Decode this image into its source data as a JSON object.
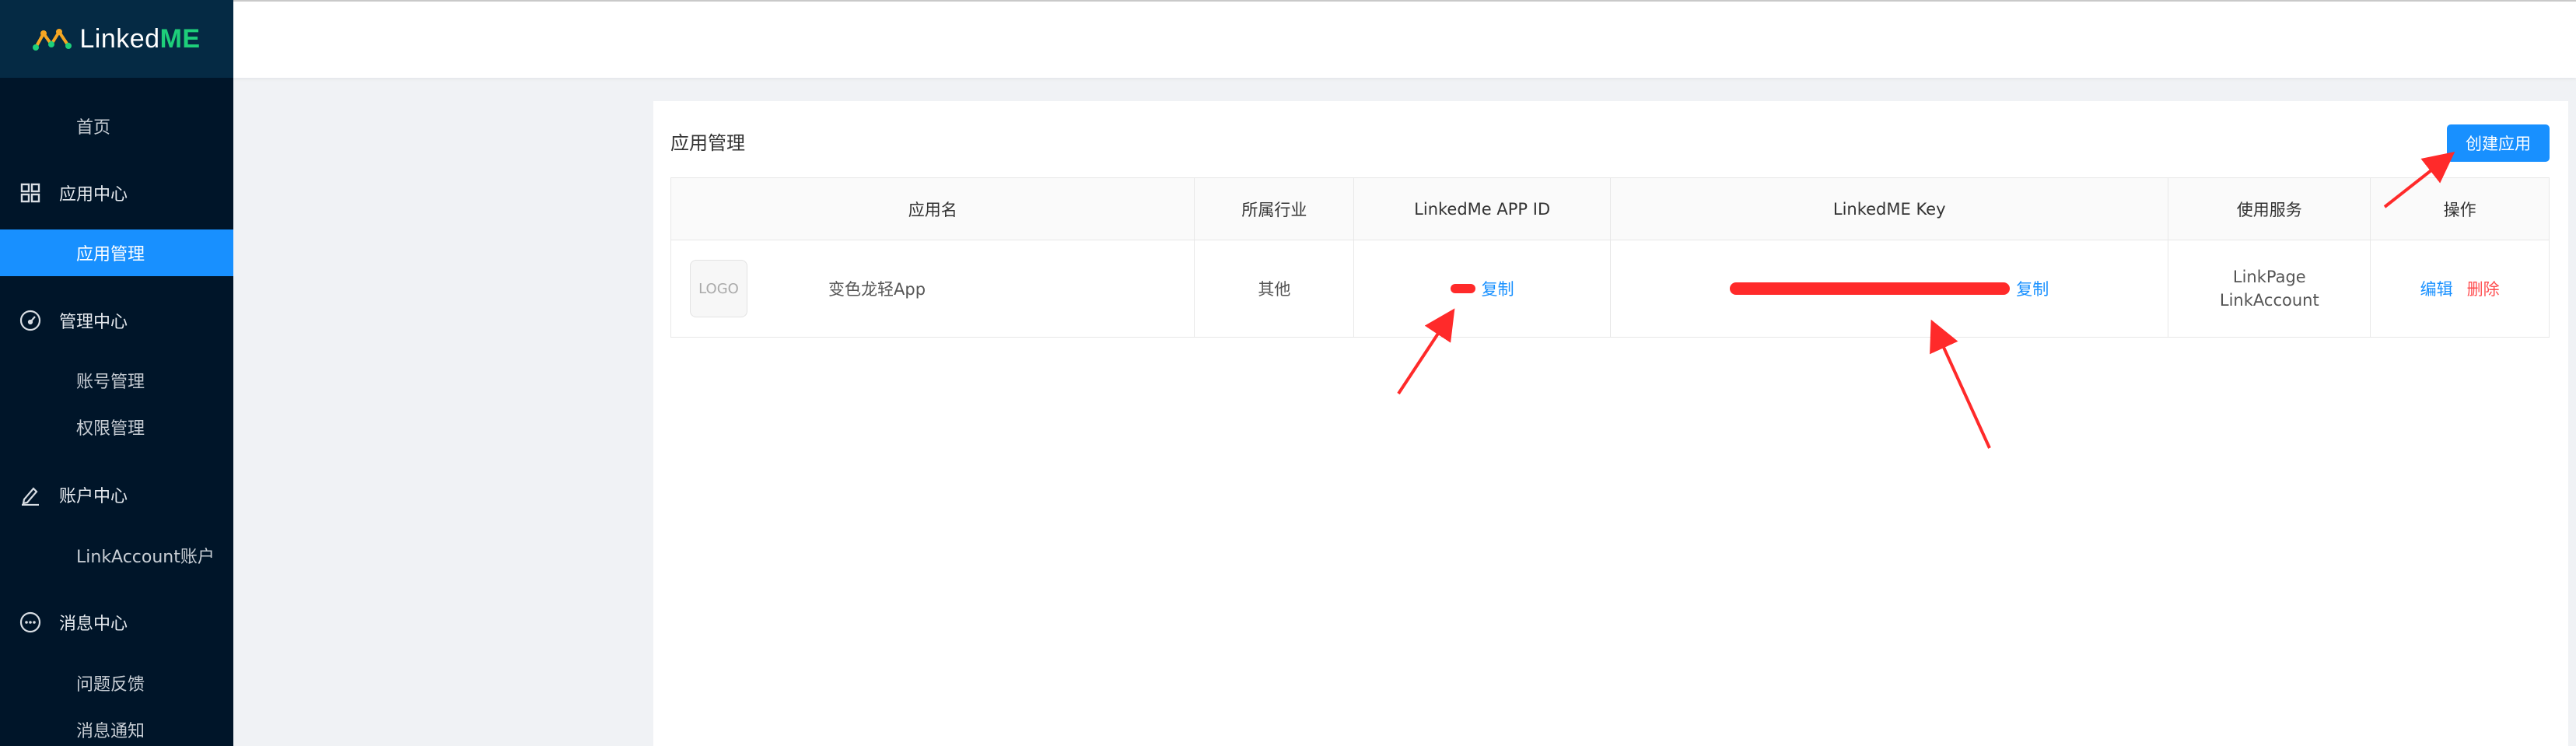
{
  "brand": {
    "name_prefix": "LinkedME",
    "logo_prefix": "Linked",
    "logo_suffix": "ME"
  },
  "sidebar": {
    "items": [
      {
        "label": "首页",
        "type": "item",
        "name": "sidebar-item-home"
      },
      {
        "label": "应用中心",
        "type": "group",
        "icon": "grid-icon",
        "name": "sidebar-group-app-center"
      },
      {
        "label": "应用管理",
        "type": "item",
        "active": true,
        "name": "sidebar-item-app-management"
      },
      {
        "label": "管理中心",
        "type": "group",
        "icon": "dashboard-icon",
        "name": "sidebar-group-management-center"
      },
      {
        "label": "账号管理",
        "type": "item",
        "name": "sidebar-item-account-management"
      },
      {
        "label": "权限管理",
        "type": "item",
        "name": "sidebar-item-permission-management"
      },
      {
        "label": "账户中心",
        "type": "group",
        "icon": "edit-icon",
        "name": "sidebar-group-account-center"
      },
      {
        "label": "LinkAccount账户",
        "type": "item",
        "name": "sidebar-item-linkaccount"
      },
      {
        "label": "消息中心",
        "type": "group",
        "icon": "message-icon",
        "name": "sidebar-group-message-center"
      },
      {
        "label": "问题反馈",
        "type": "item",
        "name": "sidebar-item-feedback"
      },
      {
        "label": "消息通知",
        "type": "item",
        "name": "sidebar-item-notifications"
      }
    ]
  },
  "main": {
    "title": "应用管理",
    "create_label": "创建应用",
    "table": {
      "headers": [
        "应用名",
        "所属行业",
        "LinkedMe APP ID",
        "LinkedME Key",
        "使用服务",
        "操作"
      ],
      "rows": [
        {
          "logo_text": "LOGO",
          "app_name": "变色龙轻App",
          "industry": "其他",
          "copy_id_label": "复制",
          "copy_key_label": "复制",
          "service_1": "LinkPage",
          "service_2": "LinkAccount",
          "edit_label": "编辑",
          "delete_label": "删除"
        }
      ]
    }
  },
  "colors": {
    "sidebar_bg": "#001529",
    "accent": "#1890ff",
    "danger": "#ff4d4f",
    "annotation": "#ff2a2a",
    "logo_green": "#1ecf7a"
  }
}
